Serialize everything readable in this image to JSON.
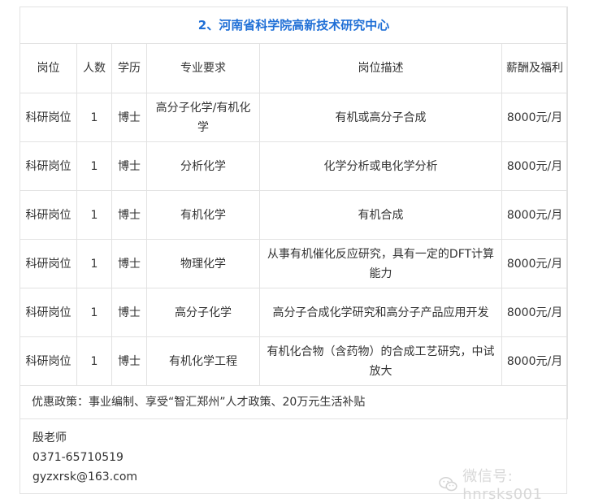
{
  "title": "2、河南省科学院高新技术研究中心",
  "headers": {
    "position": "岗位",
    "count": "人数",
    "degree": "学历",
    "major": "专业要求",
    "description": "岗位描述",
    "salary": "薪酬及福利"
  },
  "rows": [
    {
      "position": "科研岗位",
      "count": "1",
      "degree": "博士",
      "major": "高分子化学/有机化学",
      "description": "有机或高分子合成",
      "salary": "8000元/月"
    },
    {
      "position": "科研岗位",
      "count": "1",
      "degree": "博士",
      "major": "分析化学",
      "description": "化学分析或电化学分析",
      "salary": "8000元/月"
    },
    {
      "position": "科研岗位",
      "count": "1",
      "degree": "博士",
      "major": "有机化学",
      "description": "有机合成",
      "salary": "8000元/月"
    },
    {
      "position": "科研岗位",
      "count": "1",
      "degree": "博士",
      "major": "物理化学",
      "description": "从事有机催化反应研究，具有一定的DFT计算能力",
      "salary": "8000元/月"
    },
    {
      "position": "科研岗位",
      "count": "1",
      "degree": "博士",
      "major": "高分子化学",
      "description": "高分子合成化学研究和高分子产品应用开发",
      "salary": "8000元/月"
    },
    {
      "position": "科研岗位",
      "count": "1",
      "degree": "博士",
      "major": "有机化学工程",
      "description": "有机化合物（含药物）的合成工艺研究，中试放大",
      "salary": "8000元/月"
    }
  ],
  "benefits": "优惠政策：事业编制、享受“智汇郑州”人才政策、20万元生活补贴",
  "contact": {
    "name": "殷老师",
    "phone": "0371-65710519",
    "email": "gyzxrsk@163.com"
  },
  "watermark": {
    "text": "微信号: hnrsks001",
    "icon": "wechat-icon"
  }
}
